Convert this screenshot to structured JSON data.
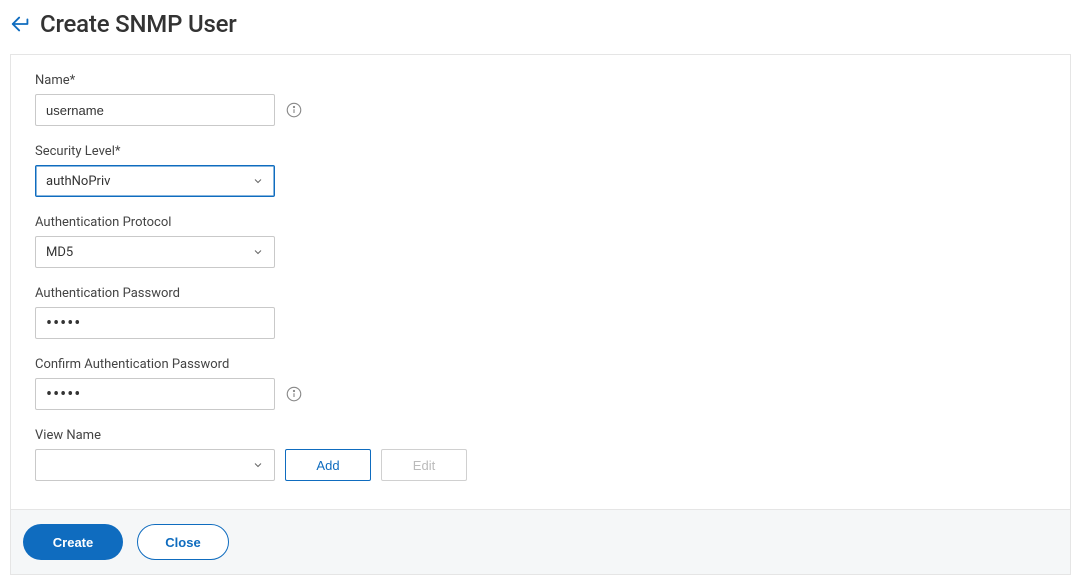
{
  "header": {
    "title": "Create SNMP User"
  },
  "form": {
    "name": {
      "label": "Name*",
      "value": "username"
    },
    "securityLevel": {
      "label": "Security Level*",
      "value": "authNoPriv"
    },
    "authProtocol": {
      "label": "Authentication Protocol",
      "value": "MD5"
    },
    "authPassword": {
      "label": "Authentication Password",
      "masked": "•••••"
    },
    "confirmAuthPassword": {
      "label": "Confirm Authentication Password",
      "masked": "•••••"
    },
    "viewName": {
      "label": "View Name",
      "value": ""
    },
    "buttons": {
      "add": "Add",
      "edit": "Edit"
    }
  },
  "footer": {
    "create": "Create",
    "close": "Close"
  }
}
